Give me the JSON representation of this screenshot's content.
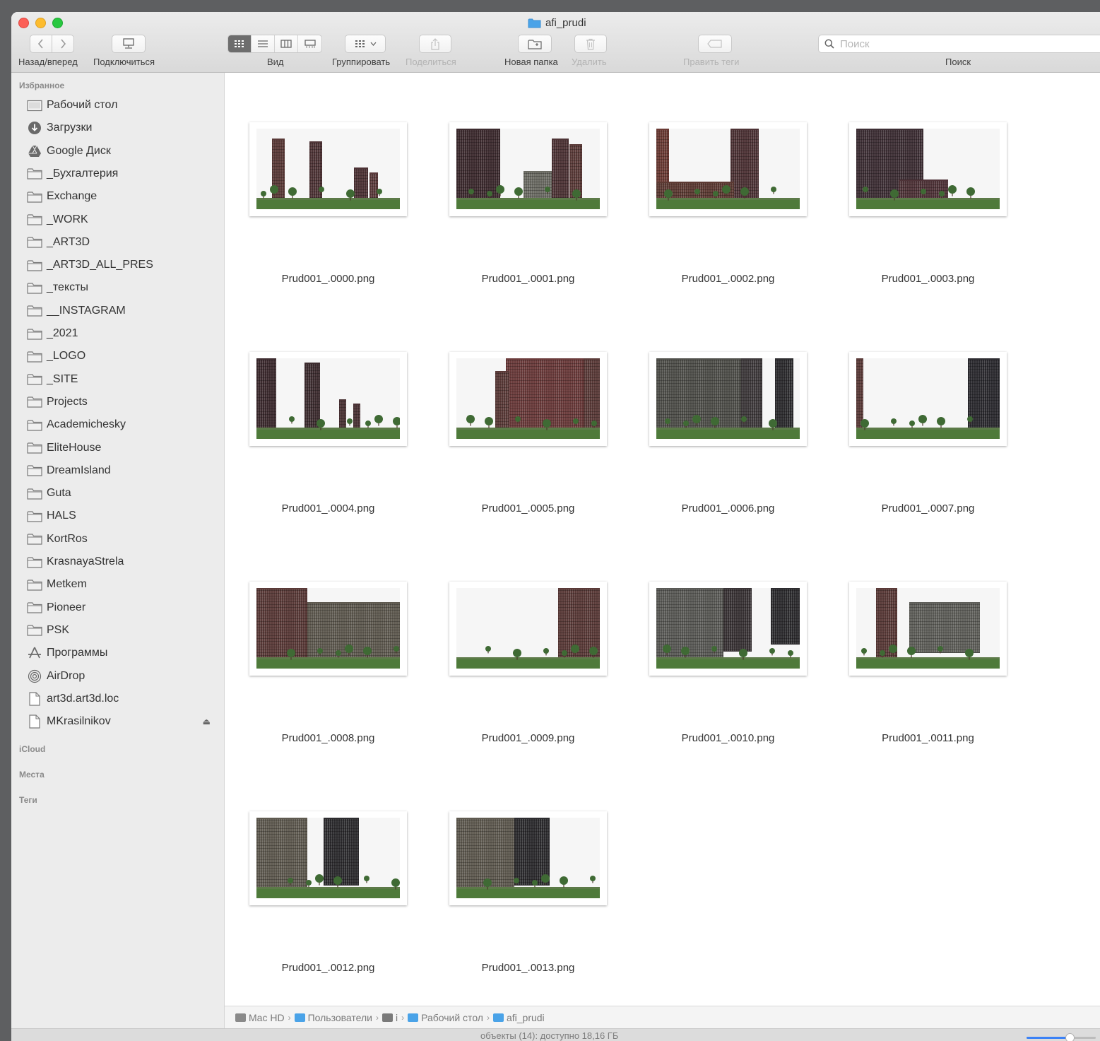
{
  "window": {
    "title": "afi_prudi"
  },
  "toolbar": {
    "back_forward_label": "Назад/вперед",
    "connect_label": "Подключиться",
    "view_label": "Вид",
    "group_label": "Группировать",
    "share_label": "Поделиться",
    "new_folder_label": "Новая папка",
    "delete_label": "Удалить",
    "tags_label": "Править теги",
    "search_label": "Поиск",
    "search_placeholder": "Поиск"
  },
  "sidebar": {
    "favorites_header": "Избранное",
    "items": [
      {
        "label": "Рабочий стол",
        "icon": "desktop-icon"
      },
      {
        "label": "Загрузки",
        "icon": "downloads-icon"
      },
      {
        "label": "Google Диск",
        "icon": "google-drive-icon"
      },
      {
        "label": "_Бухгалтерия",
        "icon": "folder-icon"
      },
      {
        "label": "Exchange",
        "icon": "folder-icon"
      },
      {
        "label": "_WORK",
        "icon": "folder-icon"
      },
      {
        "label": "_ART3D",
        "icon": "folder-icon"
      },
      {
        "label": "_ART3D_ALL_PRES",
        "icon": "folder-icon"
      },
      {
        "label": "_тексты",
        "icon": "folder-icon"
      },
      {
        "label": "__INSTAGRAM",
        "icon": "folder-icon"
      },
      {
        "label": "_2021",
        "icon": "folder-icon"
      },
      {
        "label": "_LOGO",
        "icon": "folder-icon"
      },
      {
        "label": "_SITE",
        "icon": "folder-icon"
      },
      {
        "label": "Projects",
        "icon": "folder-icon"
      },
      {
        "label": "Academichesky",
        "icon": "folder-icon"
      },
      {
        "label": "EliteHouse",
        "icon": "folder-icon"
      },
      {
        "label": "DreamIsland",
        "icon": "folder-icon"
      },
      {
        "label": "Guta",
        "icon": "folder-icon"
      },
      {
        "label": "HALS",
        "icon": "folder-icon"
      },
      {
        "label": "KortRos",
        "icon": "folder-icon"
      },
      {
        "label": "KrasnayaStrela",
        "icon": "folder-icon"
      },
      {
        "label": "Metkem",
        "icon": "folder-icon"
      },
      {
        "label": "Pioneer",
        "icon": "folder-icon"
      },
      {
        "label": "PSK",
        "icon": "folder-icon"
      },
      {
        "label": "Программы",
        "icon": "applications-icon"
      },
      {
        "label": "AirDrop",
        "icon": "airdrop-icon"
      },
      {
        "label": "art3d.art3d.loc",
        "icon": "document-icon"
      },
      {
        "label": "MKrasilnikov",
        "icon": "document-icon"
      }
    ],
    "eject_symbol": "⏏",
    "icloud_header": "iCloud",
    "places_header": "Места",
    "tags_header": "Теги"
  },
  "files": [
    {
      "name": "Prud001_.0000.png"
    },
    {
      "name": "Prud001_.0001.png"
    },
    {
      "name": "Prud001_.0002.png"
    },
    {
      "name": "Prud001_.0003.png"
    },
    {
      "name": "Prud001_.0004.png"
    },
    {
      "name": "Prud001_.0005.png"
    },
    {
      "name": "Prud001_.0006.png"
    },
    {
      "name": "Prud001_.0007.png"
    },
    {
      "name": "Prud001_.0008.png"
    },
    {
      "name": "Prud001_.0009.png"
    },
    {
      "name": "Prud001_.0010.png"
    },
    {
      "name": "Prud001_.0011.png"
    },
    {
      "name": "Prud001_.0012.png"
    },
    {
      "name": "Prud001_.0013.png"
    }
  ],
  "pathbar": {
    "segments": [
      "Mac HD",
      "Пользователи",
      "i",
      "Рабочий стол",
      "afi_prudi"
    ]
  },
  "status": {
    "text": "объекты (14): доступно 18,16 ГБ"
  },
  "zoom": {
    "fraction": 0.62
  },
  "colors": {
    "folder_blue": "#4aa3e8",
    "accent": "#3b82f6",
    "brick": "#6d3b33",
    "grass": "#4e7a3a"
  }
}
